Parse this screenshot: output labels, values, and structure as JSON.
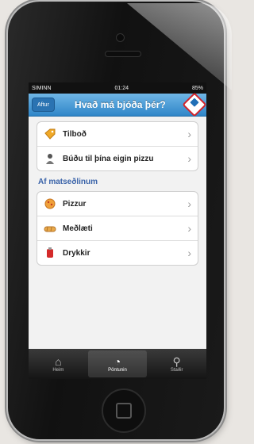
{
  "status": {
    "carrier": "SIMINN",
    "time": "01:24",
    "battery": "85%"
  },
  "nav": {
    "back_label": "Aftur",
    "title": "Hvað má bjóða þér?"
  },
  "menu_top": [
    {
      "label": "Tilboð",
      "icon": "tag-icon"
    },
    {
      "label": "Búðu til þína eigin pizzu",
      "icon": "chef-icon"
    }
  ],
  "section_title": "Af matseðlinum",
  "menu_items": [
    {
      "label": "Pizzur",
      "icon": "pizza-icon"
    },
    {
      "label": "Meðlæti",
      "icon": "sides-icon"
    },
    {
      "label": "Drykkir",
      "icon": "drink-icon"
    }
  ],
  "tabs": [
    {
      "label": "Heim",
      "icon": "home-icon",
      "active": false
    },
    {
      "label": "Pöntunin",
      "icon": "timer-icon",
      "active": true
    },
    {
      "label": "Staðir",
      "icon": "location-icon",
      "active": false
    }
  ]
}
